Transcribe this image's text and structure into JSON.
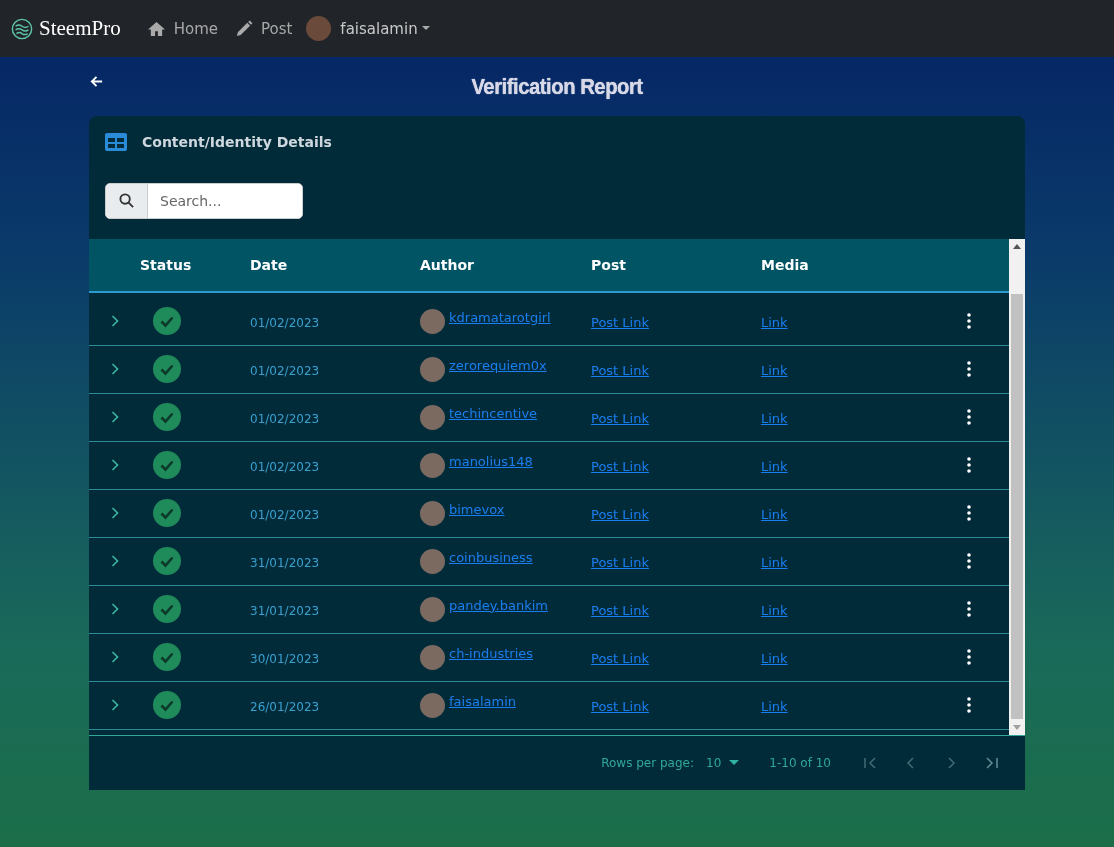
{
  "navbar": {
    "brand": "SteemPro",
    "links": [
      {
        "label": "Home"
      },
      {
        "label": "Post"
      }
    ],
    "user": "faisalamin"
  },
  "page": {
    "title": "Verification Report"
  },
  "card": {
    "title": "Content/Identity Details",
    "search": {
      "placeholder": "Search..."
    }
  },
  "table": {
    "columns": [
      "Status",
      "Date",
      "Author",
      "Post",
      "Media"
    ],
    "rows": [
      {
        "verified": true,
        "date": "01/02/2023",
        "author": "kdramatarotgirl",
        "post": "Post Link",
        "media": "Link"
      },
      {
        "verified": true,
        "date": "01/02/2023",
        "author": "zerorequiem0x",
        "post": "Post Link",
        "media": "Link"
      },
      {
        "verified": true,
        "date": "01/02/2023",
        "author": "techincentive",
        "post": "Post Link",
        "media": "Link"
      },
      {
        "verified": true,
        "date": "01/02/2023",
        "author": "manolius148",
        "post": "Post Link",
        "media": "Link"
      },
      {
        "verified": true,
        "date": "01/02/2023",
        "author": "bimevox",
        "post": "Post Link",
        "media": "Link"
      },
      {
        "verified": true,
        "date": "31/01/2023",
        "author": "coinbusiness",
        "post": "Post Link",
        "media": "Link"
      },
      {
        "verified": true,
        "date": "31/01/2023",
        "author": "pandey.bankim",
        "post": "Post Link",
        "media": "Link"
      },
      {
        "verified": true,
        "date": "30/01/2023",
        "author": "ch-industries",
        "post": "Post Link",
        "media": "Link"
      },
      {
        "verified": true,
        "date": "26/01/2023",
        "author": "faisalamin",
        "post": "Post Link",
        "media": "Link"
      }
    ]
  },
  "pagination": {
    "rows_label": "Rows per page:",
    "rows_value": "10",
    "range": "1-10 of 10",
    "buttons": [
      {
        "kind": "first",
        "disabled": true
      },
      {
        "kind": "prev",
        "disabled": true
      },
      {
        "kind": "next",
        "disabled": true
      },
      {
        "kind": "last",
        "disabled": true
      }
    ]
  }
}
